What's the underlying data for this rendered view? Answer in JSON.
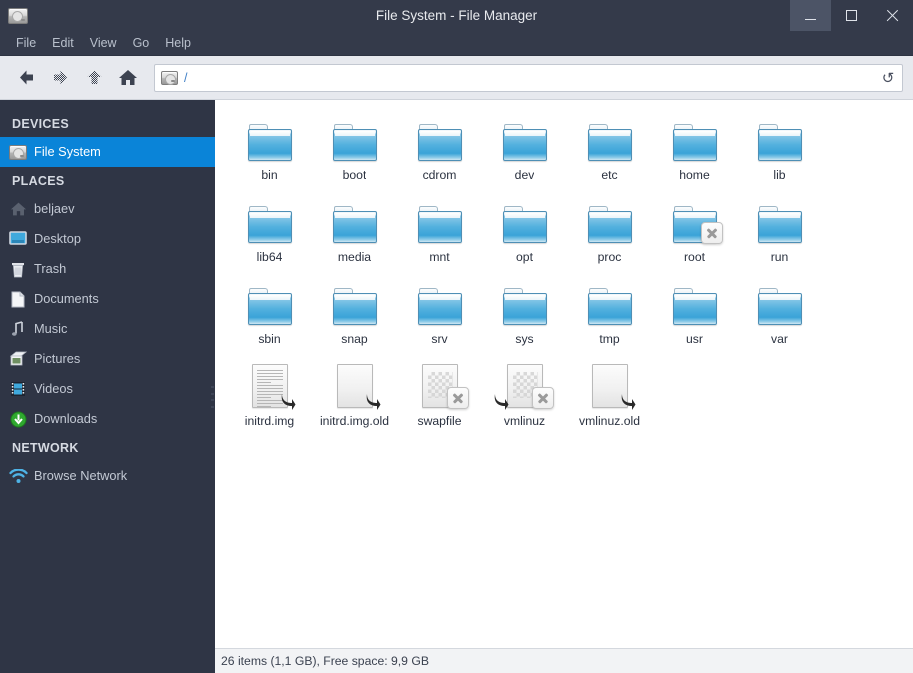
{
  "window": {
    "title": "File System - File Manager",
    "app_icon": "harddisk-icon",
    "controls": {
      "minimize": "minimize-button",
      "maximize": "maximize-button",
      "close": "close-button"
    }
  },
  "menubar": {
    "items": [
      {
        "label": "File"
      },
      {
        "label": "Edit"
      },
      {
        "label": "View"
      },
      {
        "label": "Go"
      },
      {
        "label": "Help"
      }
    ]
  },
  "toolbar": {
    "back": "back-icon",
    "forward": "forward-icon",
    "up": "up-icon",
    "home": "home-icon",
    "reload_glyph": "↺",
    "path": {
      "icon": "harddisk-icon",
      "value": "/"
    }
  },
  "sidebar": {
    "groups": [
      {
        "title": "DEVICES",
        "items": [
          {
            "label": "File System",
            "icon": "harddisk-icon",
            "selected": true
          }
        ]
      },
      {
        "title": "PLACES",
        "items": [
          {
            "label": "beljaev",
            "icon": "home-icon",
            "selected": false
          },
          {
            "label": "Desktop",
            "icon": "desktop-icon",
            "selected": false
          },
          {
            "label": "Trash",
            "icon": "trash-icon",
            "selected": false
          },
          {
            "label": "Documents",
            "icon": "document-icon",
            "selected": false
          },
          {
            "label": "Music",
            "icon": "music-note-icon",
            "selected": false
          },
          {
            "label": "Pictures",
            "icon": "pictures-icon",
            "selected": false
          },
          {
            "label": "Videos",
            "icon": "video-film-icon",
            "selected": false
          },
          {
            "label": "Downloads",
            "icon": "download-icon",
            "selected": false
          }
        ]
      },
      {
        "title": "NETWORK",
        "items": [
          {
            "label": "Browse Network",
            "icon": "wifi-icon",
            "selected": false
          }
        ]
      }
    ]
  },
  "file_view": {
    "items": [
      {
        "name": "bin",
        "type": "folder",
        "emblems": []
      },
      {
        "name": "boot",
        "type": "folder",
        "emblems": []
      },
      {
        "name": "cdrom",
        "type": "folder",
        "emblems": []
      },
      {
        "name": "dev",
        "type": "folder",
        "emblems": []
      },
      {
        "name": "etc",
        "type": "folder",
        "emblems": []
      },
      {
        "name": "home",
        "type": "folder",
        "emblems": []
      },
      {
        "name": "lib",
        "type": "folder",
        "emblems": []
      },
      {
        "name": "lib64",
        "type": "folder",
        "emblems": []
      },
      {
        "name": "media",
        "type": "folder",
        "emblems": []
      },
      {
        "name": "mnt",
        "type": "folder",
        "emblems": []
      },
      {
        "name": "opt",
        "type": "folder",
        "emblems": []
      },
      {
        "name": "proc",
        "type": "folder",
        "emblems": []
      },
      {
        "name": "root",
        "type": "folder",
        "emblems": [
          "noaccess"
        ]
      },
      {
        "name": "run",
        "type": "folder",
        "emblems": []
      },
      {
        "name": "sbin",
        "type": "folder",
        "emblems": []
      },
      {
        "name": "snap",
        "type": "folder",
        "emblems": []
      },
      {
        "name": "srv",
        "type": "folder",
        "emblems": []
      },
      {
        "name": "sys",
        "type": "folder",
        "emblems": []
      },
      {
        "name": "tmp",
        "type": "folder",
        "emblems": []
      },
      {
        "name": "usr",
        "type": "folder",
        "emblems": []
      },
      {
        "name": "var",
        "type": "folder",
        "emblems": []
      },
      {
        "name": "initrd.img",
        "type": "text-file",
        "emblems": [
          "symlink-right"
        ]
      },
      {
        "name": "initrd.img.old",
        "type": "blank-file",
        "emblems": [
          "symlink-right"
        ]
      },
      {
        "name": "swapfile",
        "type": "unknown-file",
        "emblems": [
          "noaccess"
        ]
      },
      {
        "name": "vmlinuz",
        "type": "unknown-file",
        "emblems": [
          "symlink-left",
          "noaccess"
        ]
      },
      {
        "name": "vmlinuz.old",
        "type": "blank-file",
        "emblems": [
          "symlink-right"
        ]
      }
    ]
  },
  "statusbar": {
    "text": "26 items (1,1 GB), Free space: 9,9 GB"
  },
  "colors": {
    "titlebar": "#343a4a",
    "sidebar": "#2f3545",
    "selection": "#0a84d8",
    "toolbar": "#e7e9ee",
    "content": "#ffffff",
    "statusbar": "#f2f3f5",
    "folder": "#52b0de",
    "path_text": "#3f7fc6"
  }
}
